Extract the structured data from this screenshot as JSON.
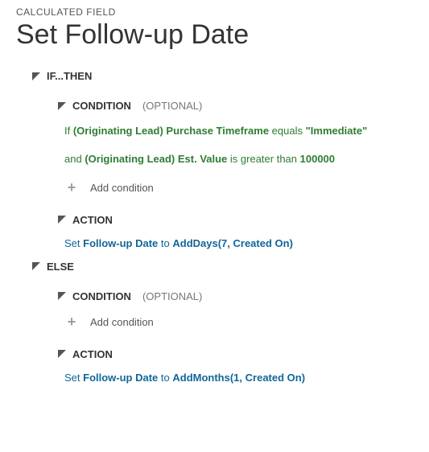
{
  "eyebrow": "CALCULATED FIELD",
  "title": "Set Follow-up Date",
  "labels": {
    "if_then": "IF...THEN",
    "else": "ELSE",
    "condition": "CONDITION",
    "optional": "(OPTIONAL)",
    "action": "ACTION",
    "add_condition": "Add condition"
  },
  "if_block": {
    "condition1": {
      "prefix": "If ",
      "field": "(Originating Lead) Purchase Timeframe",
      "operator": " equals ",
      "value": "\"Immediate\""
    },
    "condition2": {
      "prefix": "and ",
      "field": "(Originating Lead) Est. Value",
      "operator": " is greater than ",
      "value": "100000"
    },
    "action": {
      "prefix": "Set ",
      "field": "Follow-up Date",
      "mid": " to ",
      "func": "AddDays(7, Created On)"
    }
  },
  "else_block": {
    "action": {
      "prefix": "Set ",
      "field": "Follow-up Date",
      "mid": " to ",
      "func": "AddMonths(1, Created On)"
    }
  }
}
